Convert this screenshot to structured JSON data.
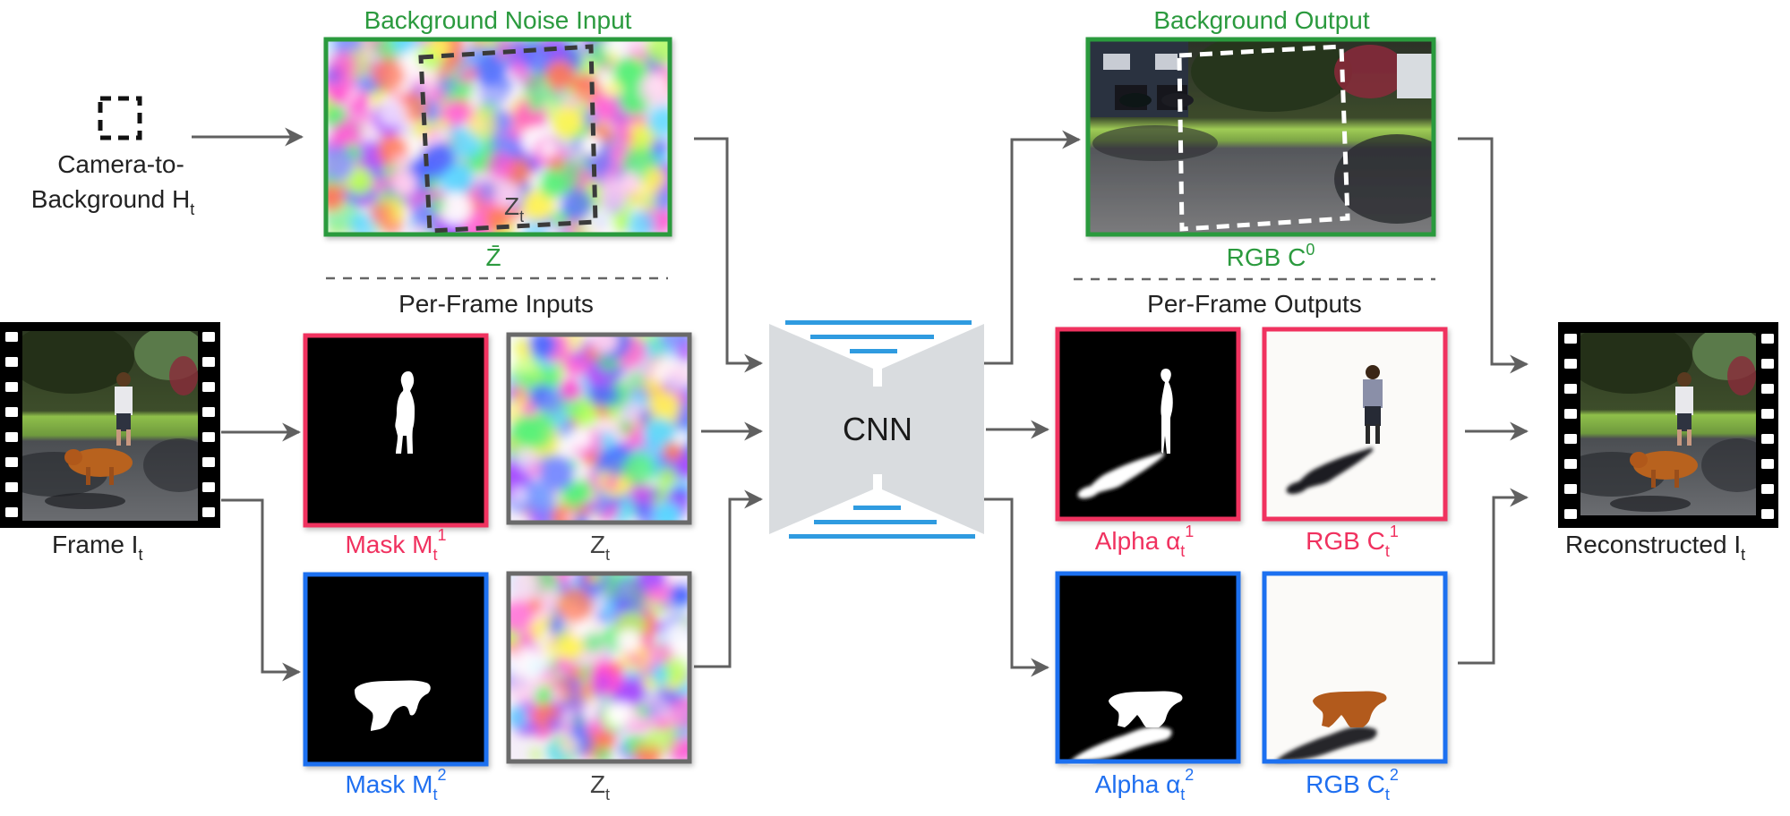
{
  "diagram": {
    "colors": {
      "background_green": "#2b9a3e",
      "layer1_pink": "#f0315f",
      "layer2_blue": "#1f6ff0",
      "noise_grey": "#6b6b6b",
      "cnn_fill": "#d9dcdf",
      "cnn_bars": "#2f9be0",
      "arrow": "#606060"
    },
    "left": {
      "camera_label_line1": "Camera-to-",
      "camera_label_line2": "Background H",
      "camera_label_sub": "t",
      "frame_label": "Frame I",
      "frame_label_sub": "t"
    },
    "background_input": {
      "title": "Background Noise Input",
      "crop_label": "Z",
      "crop_label_sub": "t",
      "caption": "Z̄"
    },
    "per_frame_inputs": {
      "title": "Per-Frame Inputs",
      "items": [
        {
          "label": "Mask M",
          "sub": "t",
          "sup": "1",
          "color": "pink"
        },
        {
          "label": "Z",
          "sub": "t",
          "sup": "",
          "color": "grey"
        },
        {
          "label": "Mask M",
          "sub": "t",
          "sup": "2",
          "color": "blue"
        },
        {
          "label": "Z",
          "sub": "t",
          "sup": "",
          "color": "grey"
        }
      ]
    },
    "cnn": {
      "label": "CNN"
    },
    "background_output": {
      "title": "Background Output",
      "caption": "RGB C",
      "caption_sup": "0"
    },
    "per_frame_outputs": {
      "title": "Per-Frame Outputs",
      "items": [
        {
          "label": "Alpha α",
          "sub": "t",
          "sup": "1",
          "color": "pink"
        },
        {
          "label": "RGB C",
          "sub": "t",
          "sup": "1",
          "color": "pink"
        },
        {
          "label": "Alpha α",
          "sub": "t",
          "sup": "2",
          "color": "blue"
        },
        {
          "label": "RGB C",
          "sub": "t",
          "sup": "2",
          "color": "blue"
        }
      ]
    },
    "right": {
      "reconstructed_label": "Reconstructed I",
      "reconstructed_sub": "t"
    }
  }
}
